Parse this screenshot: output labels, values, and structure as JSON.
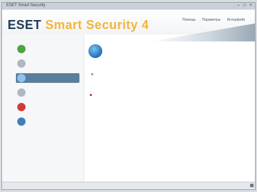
{
  "window": {
    "title": "ESET Smart Security"
  },
  "header": {
    "brand_eset": "ESET",
    "brand_product": "Smart Security 4",
    "tagline": "",
    "links": [
      "Помощь",
      "Параметры",
      "Интерфейс",
      ""
    ]
  },
  "sidebar": {
    "items": [
      {
        "label": "",
        "icon": "status-icon",
        "color": "#4aa640"
      },
      {
        "label": "",
        "icon": "scan-icon",
        "color": "#9aa6b0"
      },
      {
        "label": "",
        "icon": "update-icon",
        "color": "#3d7fc0"
      },
      {
        "label": "",
        "icon": "settings-icon",
        "color": "#9aa6b0"
      },
      {
        "label": "",
        "icon": "tools-icon",
        "color": "#d23b3b"
      },
      {
        "label": "",
        "icon": "help-icon",
        "color": "#3d7fc0"
      }
    ],
    "selected_index": 2
  },
  "main": {
    "title": "",
    "line1": "",
    "line2": "",
    "section": "",
    "row1_label": "",
    "row1_value": "",
    "row2_label": "",
    "row2_value": ""
  },
  "status_bar": {
    "left": "",
    "right": ""
  },
  "colors": {
    "accent": "#2a6aa6",
    "brand": "#f4b33c",
    "selection": "#5a7f9c"
  }
}
